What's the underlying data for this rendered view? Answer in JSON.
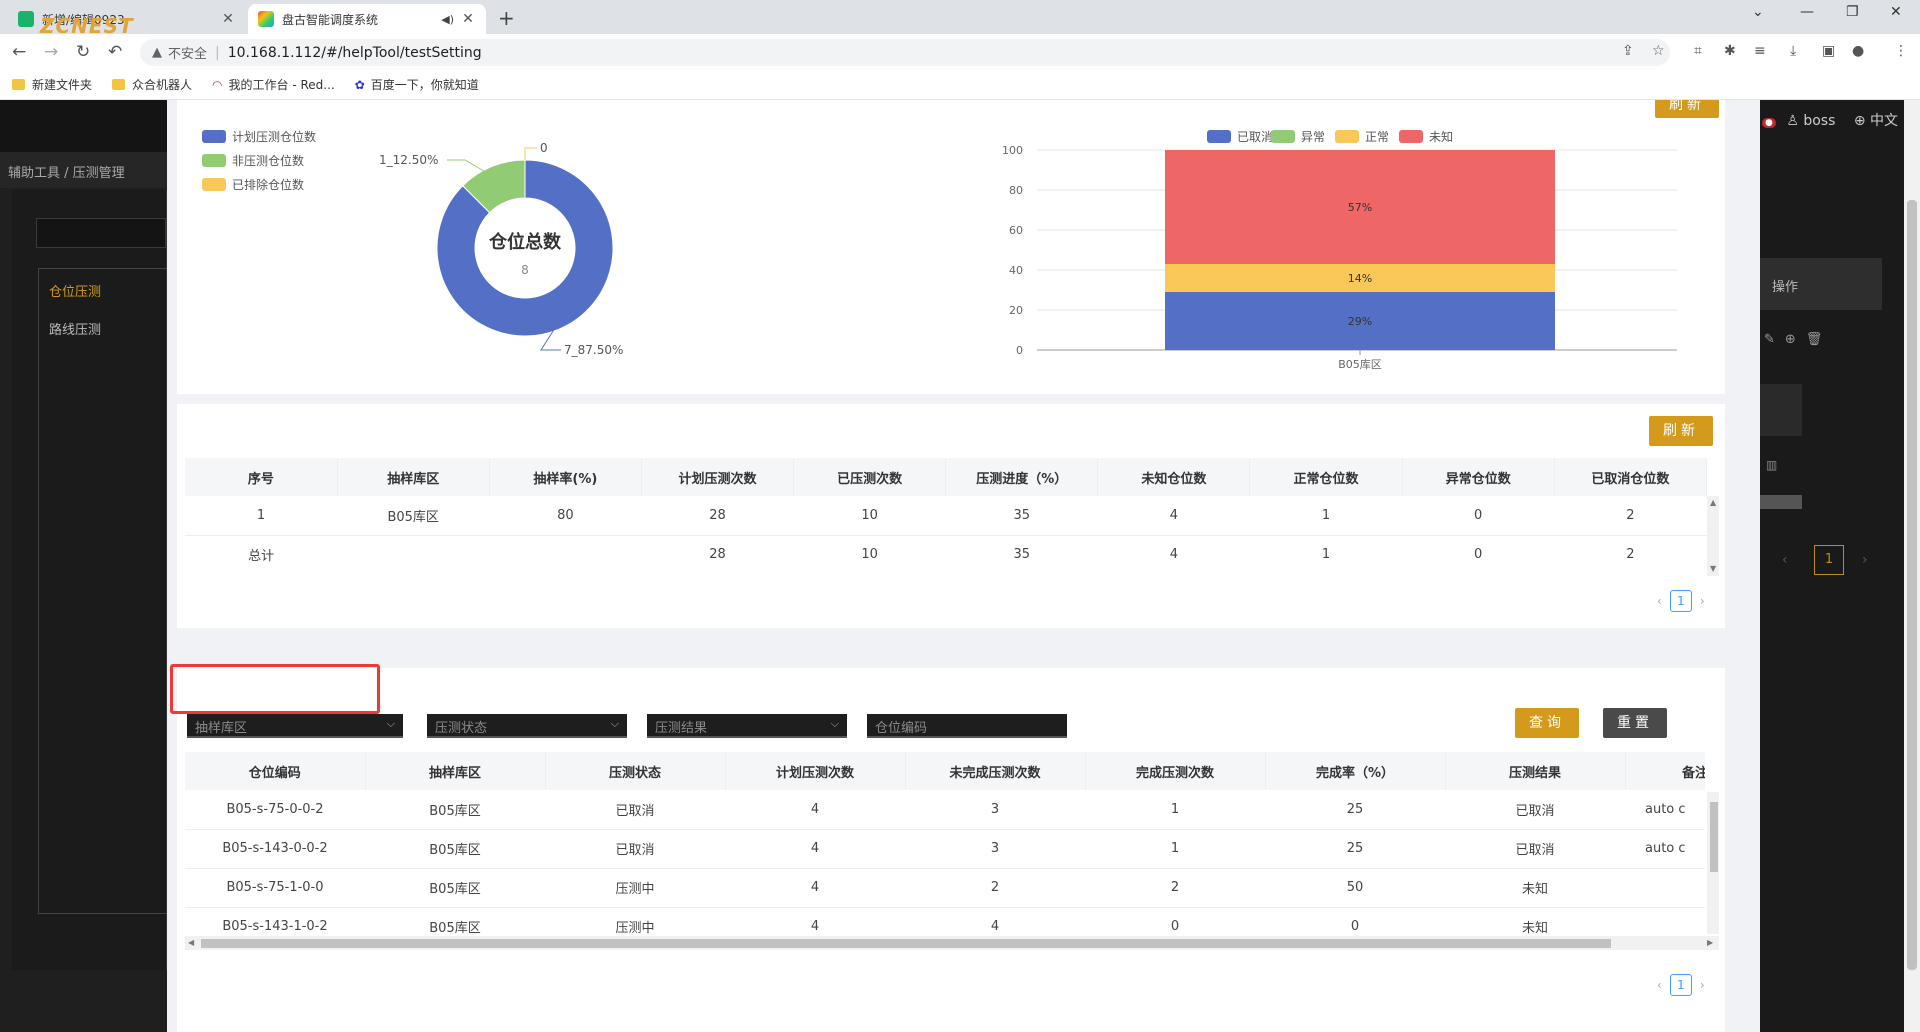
{
  "browser": {
    "tabs": [
      {
        "title": "新增/编辑0923",
        "active": false
      },
      {
        "title": "盘古智能调度系统",
        "active": true
      }
    ],
    "address": {
      "security": "不安全",
      "url": "10.168.1.112/#/helpTool/testSetting"
    },
    "bookmarks": [
      "新建文件夹",
      "众合机器人",
      "我的工作台 - Red...",
      "百度一下，你就知道"
    ]
  },
  "app": {
    "logo": "ZCNEST",
    "breadcrumb": "辅助工具 / 压测管理",
    "left_menu": [
      "仓位压测",
      "路线压测"
    ],
    "user": "boss",
    "lang": "中文",
    "ops_header": "操作",
    "page_num": "1"
  },
  "modal": {
    "refresh_top": "刷新",
    "donut": {
      "legend": [
        "计划压测仓位数",
        "非压测仓位数",
        "已排除仓位数"
      ],
      "center_title": "仓位总数",
      "center_value": "8",
      "labels": [
        "1_12.50%",
        "0",
        "7_87.50%"
      ],
      "colors": [
        "#5470c6",
        "#91cc75",
        "#fac858"
      ]
    },
    "bar_chart": {
      "legend": [
        "已取消",
        "异常",
        "正常",
        "未知"
      ],
      "colors": [
        "#5470c6",
        "#91cc75",
        "#fac858",
        "#ee6666"
      ]
    },
    "summary": {
      "refresh": "刷新",
      "headers": [
        "序号",
        "抽样库区",
        "抽样率(%)",
        "计划压测次数",
        "已压测次数",
        "压测进度（%）",
        "未知仓位数",
        "正常仓位数",
        "异常仓位数",
        "已取消仓位数"
      ],
      "rows": [
        [
          "1",
          "B05库区",
          "80",
          "28",
          "10",
          "35",
          "4",
          "1",
          "0",
          "2"
        ],
        [
          "总计",
          "",
          "",
          "28",
          "10",
          "35",
          "4",
          "1",
          "0",
          "2"
        ]
      ],
      "page": "1"
    },
    "detail": {
      "filters": {
        "area": "抽样库区",
        "status": "压测状态",
        "result": "压测结果",
        "code": "仓位编码"
      },
      "query": "查询",
      "reset": "重置",
      "headers": [
        "仓位编码",
        "抽样库区",
        "压测状态",
        "计划压测次数",
        "未完成压测次数",
        "完成压测次数",
        "完成率（%）",
        "压测结果",
        "备注"
      ],
      "rows": [
        [
          "B05-s-75-0-0-2",
          "B05库区",
          "已取消",
          "4",
          "3",
          "1",
          "25",
          "已取消",
          "auto c"
        ],
        [
          "B05-s-143-0-0-2",
          "B05库区",
          "已取消",
          "4",
          "3",
          "1",
          "25",
          "已取消",
          "auto c"
        ],
        [
          "B05-s-75-1-0-0",
          "B05库区",
          "压测中",
          "4",
          "2",
          "2",
          "50",
          "未知",
          ""
        ],
        [
          "B05-s-143-1-0-2",
          "B05库区",
          "压测中",
          "4",
          "4",
          "0",
          "0",
          "未知",
          ""
        ]
      ],
      "page": "1"
    }
  },
  "chart_data": [
    {
      "type": "pie",
      "title": "仓位总数",
      "center_value": 8,
      "legend": [
        "计划压测仓位数",
        "非压测仓位数",
        "已排除仓位数"
      ],
      "values": [
        7,
        1,
        0
      ],
      "labels": [
        "7_87.50%",
        "1_12.50%",
        "0"
      ]
    },
    {
      "type": "bar",
      "stacked": true,
      "categories": [
        "B05库区"
      ],
      "ylim": [
        0,
        100
      ],
      "yticks": [
        0,
        20,
        40,
        60,
        80,
        100
      ],
      "legend_position": "top",
      "series": [
        {
          "name": "已取消",
          "values": [
            29
          ],
          "label": "29%"
        },
        {
          "name": "异常",
          "values": [
            0
          ],
          "label": ""
        },
        {
          "name": "正常",
          "values": [
            14
          ],
          "label": "14%"
        },
        {
          "name": "未知",
          "values": [
            57
          ],
          "label": "57%"
        }
      ]
    }
  ]
}
